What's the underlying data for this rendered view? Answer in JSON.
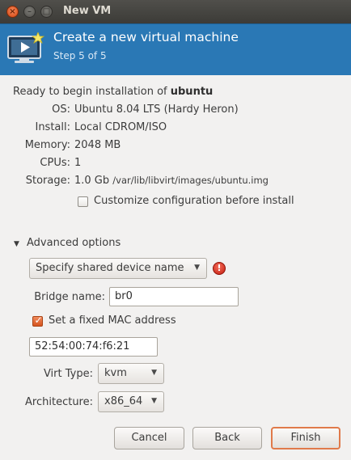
{
  "window": {
    "title": "New VM"
  },
  "banner": {
    "title": "Create a new virtual machine",
    "step": "Step 5 of 5"
  },
  "summary": {
    "intro": "Ready to begin installation of",
    "vm_name": "ubuntu",
    "rows": [
      {
        "label": "OS:",
        "value": "Ubuntu 8.04 LTS (Hardy Heron)"
      },
      {
        "label": "Install:",
        "value": "Local CDROM/ISO"
      },
      {
        "label": "Memory:",
        "value": "2048 MB"
      },
      {
        "label": "CPUs:",
        "value": "1"
      },
      {
        "label": "Storage:",
        "value": "1.0 Gb",
        "path": "/var/lib/libvirt/images/ubuntu.img"
      }
    ]
  },
  "customize": {
    "label": "Customize configuration before install",
    "checked": false
  },
  "advanced": {
    "label": "Advanced options",
    "network_select": "Specify shared device name",
    "bridge_label": "Bridge name:",
    "bridge_value": "br0",
    "mac_checkbox_label": "Set a fixed MAC address",
    "mac_checked": true,
    "mac_value": "52:54:00:74:f6:21",
    "virt_type_label": "Virt Type:",
    "virt_type_value": "kvm",
    "arch_label": "Architecture:",
    "arch_value": "x86_64"
  },
  "buttons": {
    "cancel": "Cancel",
    "back": "Back",
    "finish": "Finish"
  },
  "icons": {
    "close": "close-icon",
    "minimize": "minimize-icon",
    "maximize": "maximize-icon",
    "monitor": "monitor-icon",
    "warning": "error-icon"
  },
  "colors": {
    "banner": "#2a78b5",
    "accent": "#e07a4a",
    "error": "#c41d10"
  }
}
